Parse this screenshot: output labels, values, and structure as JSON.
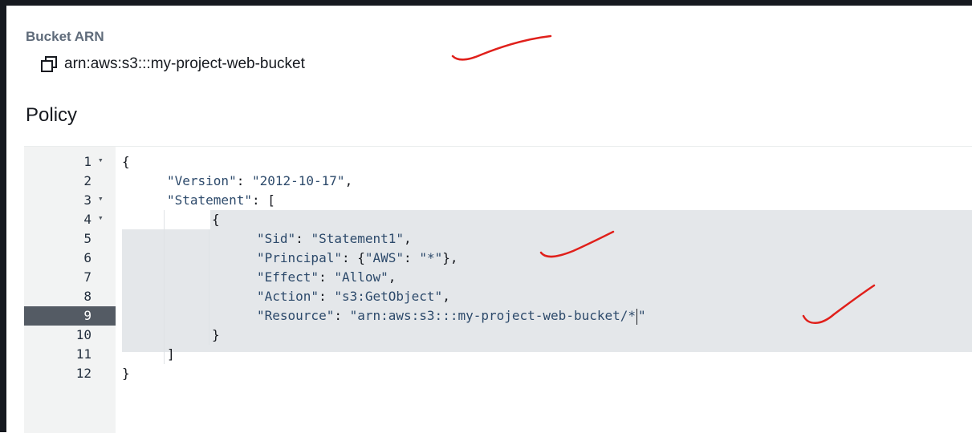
{
  "bucket_arn": {
    "label": "Bucket ARN",
    "value": "arn:aws:s3:::my-project-web-bucket",
    "copy_icon": "copy-icon"
  },
  "policy": {
    "title": "Policy",
    "active_line": 9,
    "line_numbers": [
      "1",
      "2",
      "3",
      "4",
      "5",
      "6",
      "7",
      "8",
      "9",
      "10",
      "11",
      "12"
    ],
    "lines": [
      {
        "n": 1,
        "fold": true,
        "indent": 0,
        "tokens": [
          {
            "t": "p",
            "v": "{"
          }
        ]
      },
      {
        "n": 2,
        "fold": false,
        "indent": 1,
        "tokens": [
          {
            "t": "key",
            "v": "\"Version\""
          },
          {
            "t": "p",
            "v": ": "
          },
          {
            "t": "str",
            "v": "\"2012-10-17\""
          },
          {
            "t": "p",
            "v": ","
          }
        ]
      },
      {
        "n": 3,
        "fold": true,
        "indent": 1,
        "tokens": [
          {
            "t": "key",
            "v": "\"Statement\""
          },
          {
            "t": "p",
            "v": ": ["
          }
        ]
      },
      {
        "n": 4,
        "fold": true,
        "indent": 2,
        "tokens": [
          {
            "t": "p",
            "v": "{"
          }
        ]
      },
      {
        "n": 5,
        "fold": false,
        "indent": 3,
        "tokens": [
          {
            "t": "key",
            "v": "\"Sid\""
          },
          {
            "t": "p",
            "v": ": "
          },
          {
            "t": "str",
            "v": "\"Statement1\""
          },
          {
            "t": "p",
            "v": ","
          }
        ]
      },
      {
        "n": 6,
        "fold": false,
        "indent": 3,
        "tokens": [
          {
            "t": "key",
            "v": "\"Principal\""
          },
          {
            "t": "p",
            "v": ": {"
          },
          {
            "t": "key",
            "v": "\"AWS\""
          },
          {
            "t": "p",
            "v": ": "
          },
          {
            "t": "str",
            "v": "\"*\""
          },
          {
            "t": "p",
            "v": "},"
          }
        ]
      },
      {
        "n": 7,
        "fold": false,
        "indent": 3,
        "tokens": [
          {
            "t": "key",
            "v": "\"Effect\""
          },
          {
            "t": "p",
            "v": ": "
          },
          {
            "t": "str",
            "v": "\"Allow\""
          },
          {
            "t": "p",
            "v": ","
          }
        ]
      },
      {
        "n": 8,
        "fold": false,
        "indent": 3,
        "tokens": [
          {
            "t": "key",
            "v": "\"Action\""
          },
          {
            "t": "p",
            "v": ": "
          },
          {
            "t": "str",
            "v": "\"s3:GetObject\""
          },
          {
            "t": "p",
            "v": ","
          }
        ]
      },
      {
        "n": 9,
        "fold": false,
        "indent": 3,
        "tokens": [
          {
            "t": "key",
            "v": "\"Resource\""
          },
          {
            "t": "p",
            "v": ": "
          },
          {
            "t": "str",
            "v": "\"arn:aws:s3:::my-project-web-bucket/*"
          },
          {
            "t": "cursor",
            "v": ""
          },
          {
            "t": "str",
            "v": "\""
          }
        ]
      },
      {
        "n": 10,
        "fold": false,
        "indent": 2,
        "tokens": [
          {
            "t": "p",
            "v": "}"
          }
        ]
      },
      {
        "n": 11,
        "fold": false,
        "indent": 1,
        "tokens": [
          {
            "t": "p",
            "v": "]"
          }
        ]
      },
      {
        "n": 12,
        "fold": false,
        "indent": 0,
        "tokens": [
          {
            "t": "p",
            "v": "}"
          }
        ]
      }
    ]
  },
  "annotations": {
    "color": "#e0201b",
    "marks": [
      "handwritten-checkmark",
      "handwritten-checkmark",
      "handwritten-checkmark"
    ]
  }
}
